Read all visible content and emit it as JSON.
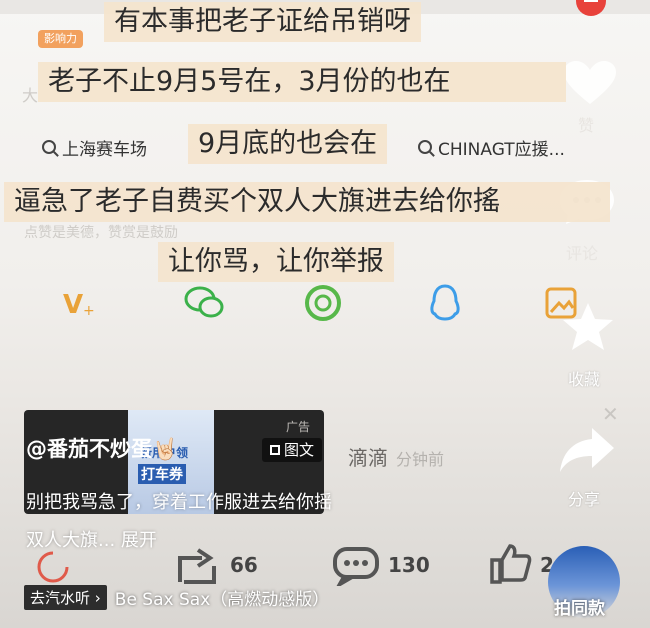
{
  "badge": {
    "label": "影响力"
  },
  "faded": {
    "left_char": "大",
    "subtitle": "点赞是美德，赞赏是鼓励"
  },
  "search_chips": [
    {
      "label": "上海赛车场"
    },
    {
      "label": "CHINAGT应援..."
    }
  ],
  "captions": [
    "有本事把老子证给吊销呀",
    "老子不止9月5号在，3月份的也在",
    "9月底的也会在",
    "逼急了老子自费买个双人大旗进去给你搖",
    "让你骂，让你举报"
  ],
  "right_column": {
    "like_faded": "赞",
    "comment_label": "评论",
    "favorite_label": "收藏",
    "share_label": "分享"
  },
  "ad": {
    "mark": "广告",
    "img_text_1": "新用户领",
    "img_text_2": "打车券",
    "brand": "滴滴",
    "faded_time": "分钟前"
  },
  "post": {
    "author": "@番茄不炒蛋🤘🏻",
    "type_tag": "图文",
    "desc_line1": "别把我骂急了，穿着工作服进去给你摇",
    "desc_line2": "双人大旗... 展开"
  },
  "actions": {
    "repost_count": "66",
    "comment_count": "130",
    "like_count": "2"
  },
  "music": {
    "go_label": "去汽水听 ›",
    "song": "Be Sax Sax（高燃动感版）"
  },
  "same_style": "拍同款",
  "colors": {
    "caption_bg": "#f4e4ce",
    "accent_orange": "#f2a15e",
    "red": "#e8423b"
  }
}
